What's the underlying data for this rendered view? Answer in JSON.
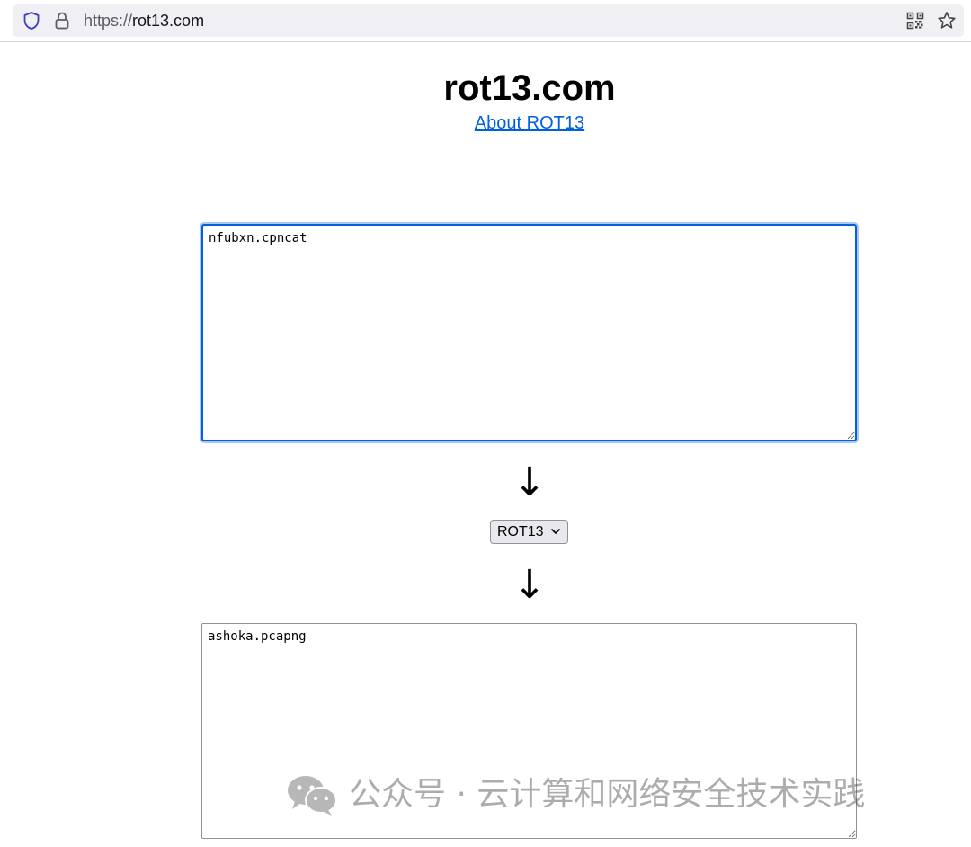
{
  "browser": {
    "url_scheme": "https://",
    "url_host": "rot13.com"
  },
  "page": {
    "title": "rot13.com",
    "about_link": "About ROT13"
  },
  "input": {
    "value": "nfubxn.cpncat"
  },
  "arrow": "↓",
  "cipher_select": {
    "selected": "ROT13"
  },
  "output": {
    "value": "ashoka.pcapng"
  },
  "watermark": {
    "text": "公众号 · 云计算和网络安全技术实践"
  },
  "colors": {
    "link": "#0060df",
    "focus_ring": "#0060df",
    "addressbar_bg": "#f0f0f4"
  },
  "icons": [
    "shield-icon",
    "lock-icon",
    "qr-code-icon",
    "bookmark-star-icon",
    "chevron-down-icon",
    "resize-grip-icon",
    "wechat-logo-icon"
  ]
}
